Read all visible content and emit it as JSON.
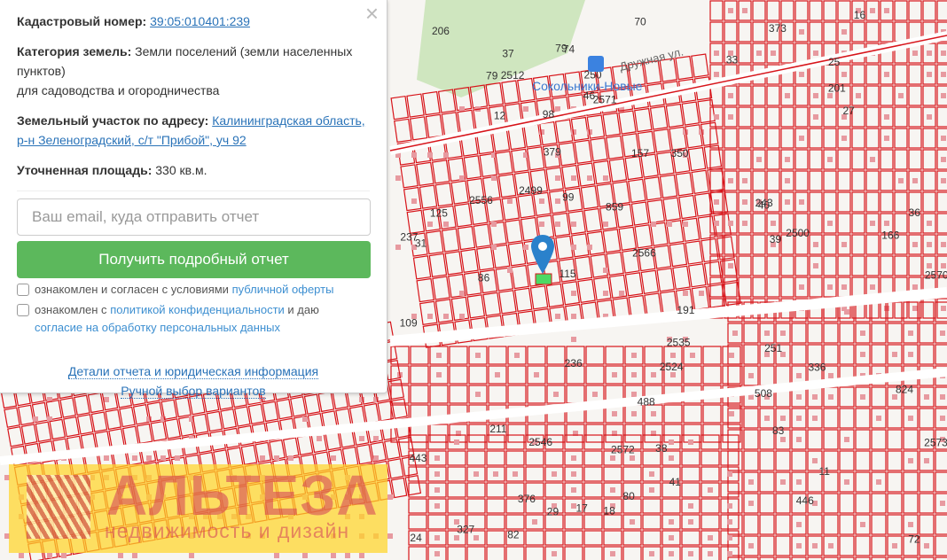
{
  "map": {
    "street_label": "Дружная ул.",
    "station_label": "Сокольники-Новые",
    "plot_labels": [
      "12",
      "29",
      "72",
      "446",
      "373",
      "38",
      "37",
      "336",
      "327",
      "16",
      "27",
      "211",
      "206",
      "376",
      "109",
      "86",
      "98",
      "824",
      "488",
      "99",
      "115",
      "79",
      "508",
      "157",
      "443",
      "251",
      "40",
      "36",
      "39",
      "250",
      "70",
      "31",
      "11",
      "25",
      "24",
      "17",
      "18",
      "237",
      "236",
      "41",
      "74",
      "125",
      "350",
      "379",
      "166",
      "2500",
      "2499",
      "2512",
      "2524",
      "2535",
      "2546",
      "2556",
      "2566",
      "2572",
      "2573",
      "2571",
      "2570",
      "859",
      "33",
      "46",
      "243",
      "191",
      "201",
      "79",
      "80",
      "83",
      "82"
    ],
    "watermark_title": "АЛЬТЕЗА",
    "watermark_subtitle": "недвижимость и дизайн"
  },
  "panel": {
    "close_label": "×",
    "cadastral_label": "Кадастровый номер:",
    "cadastral_value": "39:05:010401:239",
    "category_label": "Категория земель:",
    "category_value": "Земли поселений (земли населенных пунктов)",
    "category_use": "для садоводства и огородничества",
    "address_label": "Земельный участок по адресу:",
    "address_value": "Калининградская область, р-н Зеленоградский, с/т \"Прибой\", уч 92",
    "area_label": "Уточненная площадь:",
    "area_value": "330 кв.м.",
    "email_placeholder": "Ваш email, куда отправить отчет",
    "submit_label": "Получить подробный отчет",
    "check1_text": "ознакомлен и согласен с условиями",
    "check1_link": "публичной оферты",
    "check2_text": "ознакомлен с",
    "check2_link": "политикой конфиденциальности",
    "check2_mid": "и даю",
    "check2_link2": "согласие на обработку персональных данных",
    "details_link": "Детали отчета и юридическая информация",
    "manual_link": "Ручной выбор вариантов"
  },
  "colors": {
    "accent": "#5cb85c",
    "link": "#2a73b8",
    "parcel": "#d7141a",
    "pin": "#2a81cb"
  }
}
